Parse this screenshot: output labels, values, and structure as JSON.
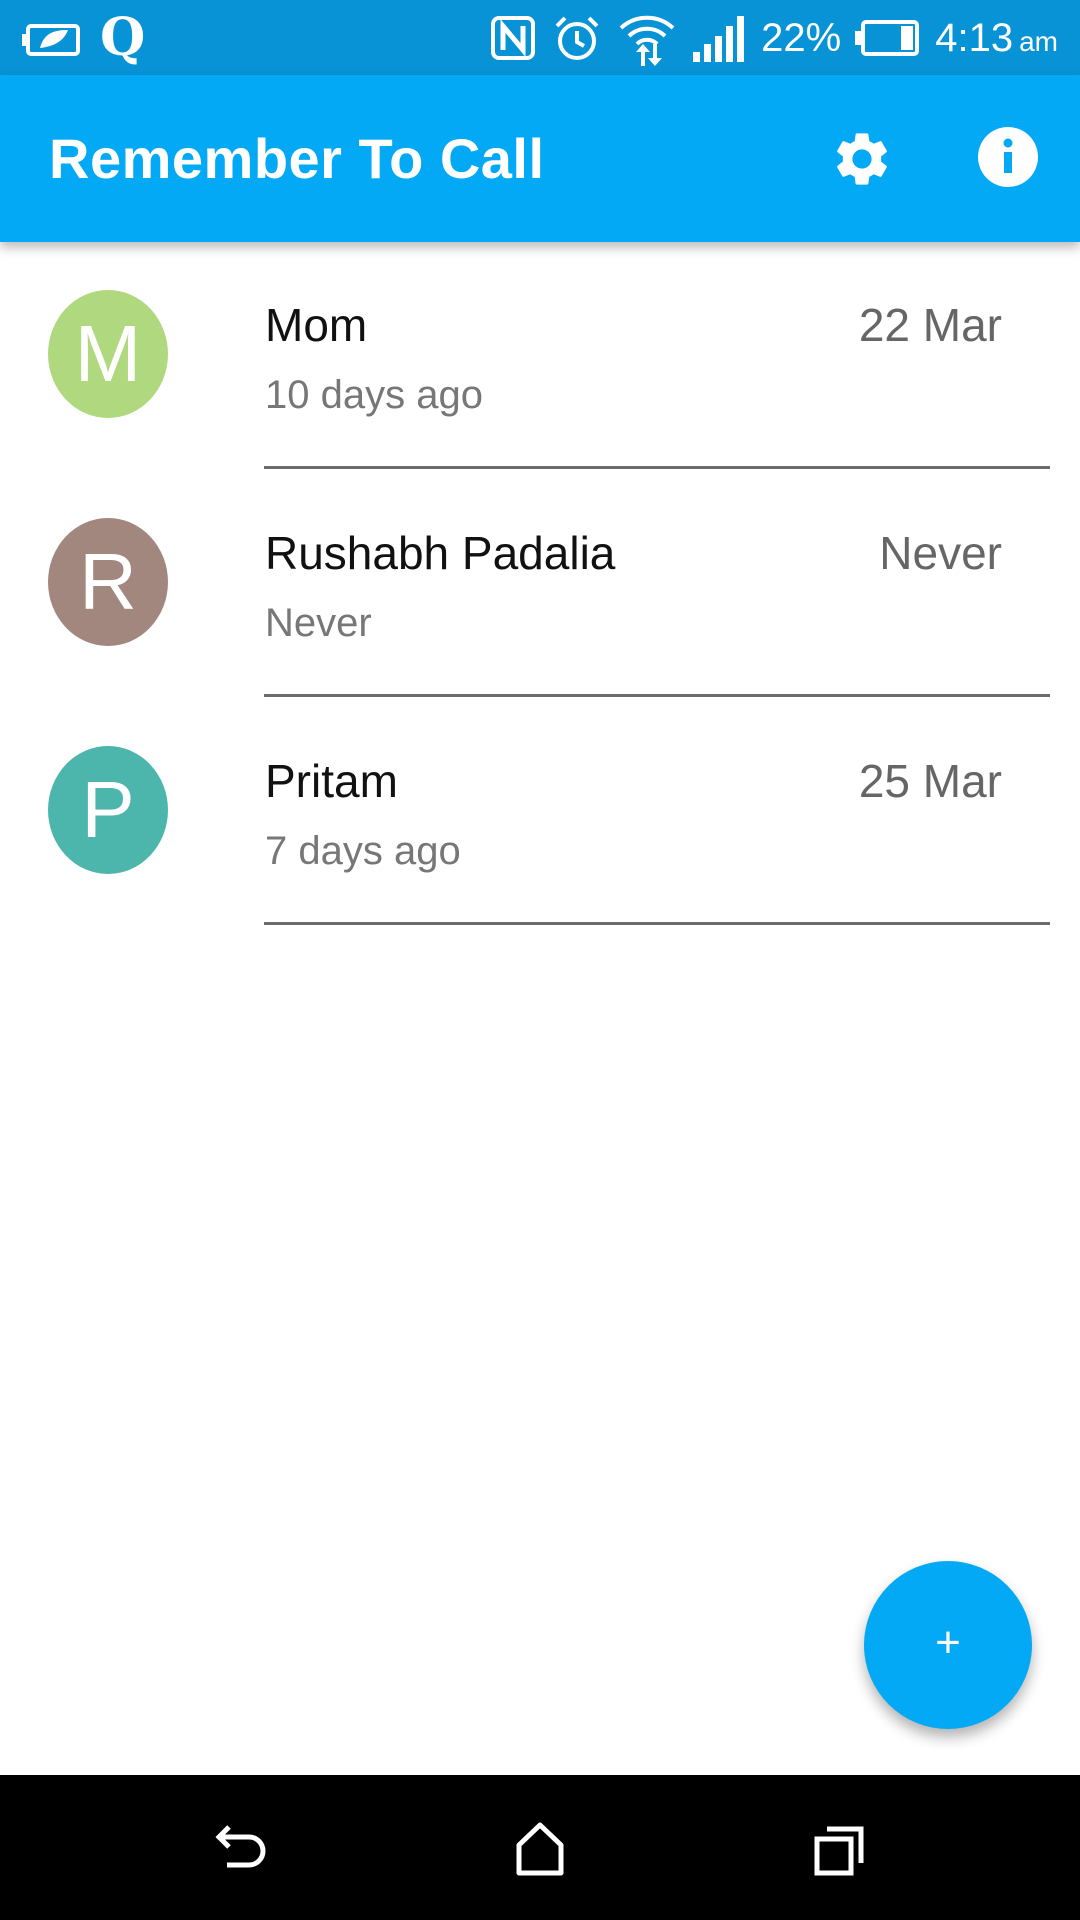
{
  "status_bar": {
    "battery_percent": "22%",
    "time": "4:13",
    "ampm": "am",
    "icons": [
      "battery-saver-icon",
      "q-app-icon",
      "nfc-icon",
      "alarm-icon",
      "wifi-icon",
      "signal-icon",
      "battery-icon"
    ]
  },
  "app_bar": {
    "title": "Remember To Call",
    "actions": [
      "settings-icon",
      "info-icon"
    ],
    "color": "#03a9f4"
  },
  "contacts": [
    {
      "initial": "M",
      "name": "Mom",
      "date": "22 Mar",
      "ago": "10 days ago",
      "color": "#b0d97f"
    },
    {
      "initial": "R",
      "name": "Rushabh Padalia",
      "date": "Never",
      "ago": "Never",
      "color": "#a1877e"
    },
    {
      "initial": "P",
      "name": "Pritam",
      "date": "25 Mar",
      "ago": "7 days ago",
      "color": "#4db6ac"
    }
  ],
  "fab": {
    "label": "+",
    "icon": "add-icon"
  },
  "nav_bar": {
    "buttons": [
      "back-icon",
      "home-icon",
      "recents-icon"
    ]
  }
}
